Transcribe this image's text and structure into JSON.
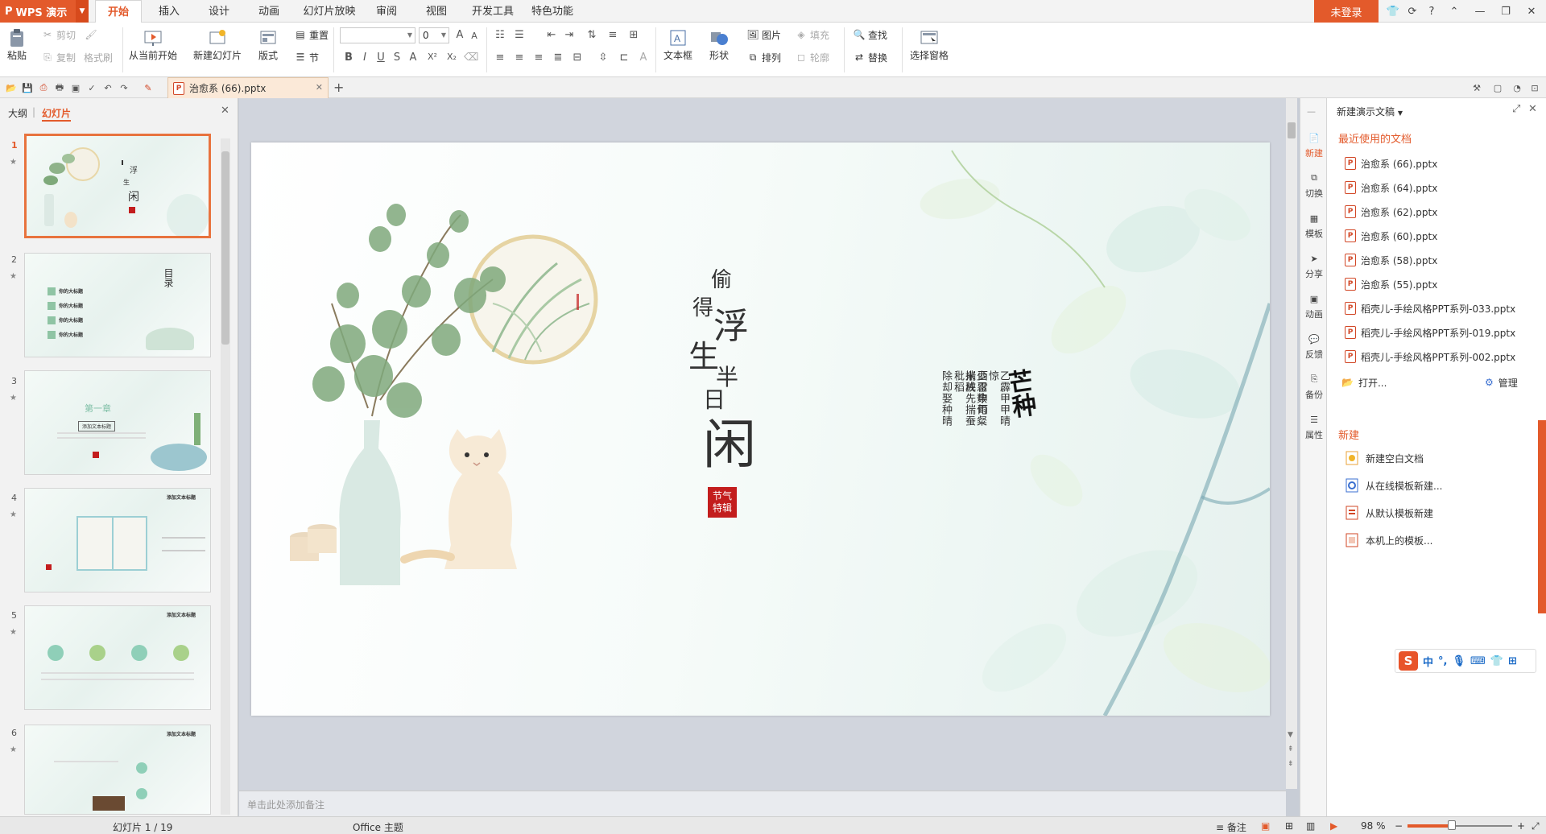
{
  "app": {
    "title": "WPS 演示"
  },
  "tabs": [
    "开始",
    "插入",
    "设计",
    "动画",
    "幻灯片放映",
    "审阅",
    "视图",
    "开发工具",
    "特色功能"
  ],
  "active_tab": "开始",
  "login_label": "未登录",
  "window_help": "?",
  "ribbon": {
    "paste": "粘贴",
    "cut": "剪切",
    "copy": "复制",
    "format_painter": "格式刷",
    "from_current": "从当前开始",
    "new_slide": "新建幻灯片",
    "layout": "版式",
    "reset": "重置",
    "section": "节",
    "font_name": "",
    "font_size": "0",
    "bold": "B",
    "italic": "I",
    "underline": "U",
    "strike": "S",
    "shadow": "A",
    "grow": "A",
    "shrink": "A",
    "superscript": "X²",
    "subscript": "X₂",
    "textbox": "文本框",
    "shape": "形状",
    "picture": "图片",
    "fill": "填充",
    "arrange": "排列",
    "outline": "轮廓",
    "find": "查找",
    "replace": "替换",
    "select_pane": "选择窗格"
  },
  "doc_tab": {
    "name": "治愈系 (66).pptx"
  },
  "left_panel": {
    "outline_tab": "大纲",
    "slides_tab": "幻灯片",
    "thumbnails": [
      {
        "num": "1"
      },
      {
        "num": "2",
        "lines": [
          "你的大标题",
          "你的大标题",
          "你的大标题",
          "你的大标题"
        ],
        "title": "目录"
      },
      {
        "num": "3",
        "title": "第一章",
        "subtitle": "添加文本标题"
      },
      {
        "num": "4",
        "title": "添加文本标题"
      },
      {
        "num": "5",
        "title": "添加文本标题"
      },
      {
        "num": "6",
        "title": "添加文本标题"
      }
    ]
  },
  "slide": {
    "title_chars": [
      "偷",
      "得",
      "浮",
      "生",
      "半",
      "日",
      "闲"
    ],
    "seal_text": "节气特辑",
    "calligraphy": "芒种",
    "poem_columns": [
      "乙酉",
      "霹雷",
      "甲申",
      "甲雨",
      "甲雨",
      "晴惊",
      "少揣",
      "忍秧",
      "数先",
      "旬揣",
      "粲蚕",
      "米秕",
      "成稻",
      "除",
      "却",
      "娶",
      "蚕",
      "种",
      "晴"
    ],
    "poem_lines": [
      "乙霹甲甲晴惊",
      "酉雷申雨",
      "少忍数旬粲米成",
      "揣秧先揣蚕秕稻",
      "除却娶种晴"
    ]
  },
  "notes_placeholder": "单击此处添加备注",
  "rail": [
    "新建",
    "切换",
    "模板",
    "分享",
    "动画",
    "反馈",
    "备份",
    "属性"
  ],
  "pane": {
    "header": "新建演示文稿",
    "recent_title": "最近使用的文档",
    "recent": [
      "治愈系 (66).pptx",
      "治愈系 (64).pptx",
      "治愈系 (62).pptx",
      "治愈系 (60).pptx",
      "治愈系 (58).pptx",
      "治愈系 (55).pptx",
      "稻壳儿-手绘风格PPT系列-033.pptx",
      "稻壳儿-手绘风格PPT系列-019.pptx",
      "稻壳儿-手绘风格PPT系列-002.pptx"
    ],
    "open": "打开...",
    "manage": "管理",
    "new_title": "新建",
    "new_items": [
      "新建空白文档",
      "从在线模板新建...",
      "从默认模板新建",
      "本机上的模板..."
    ]
  },
  "ime": {
    "lang": "中",
    "punct": "°,"
  },
  "status": {
    "slide_info": "幻灯片 1 / 19",
    "theme": "Office 主题",
    "notes": "备注",
    "zoom": "98 %",
    "zoom_level": 0.42
  },
  "colors": {
    "accent": "#e35a2b",
    "ppt": "#d24726"
  }
}
